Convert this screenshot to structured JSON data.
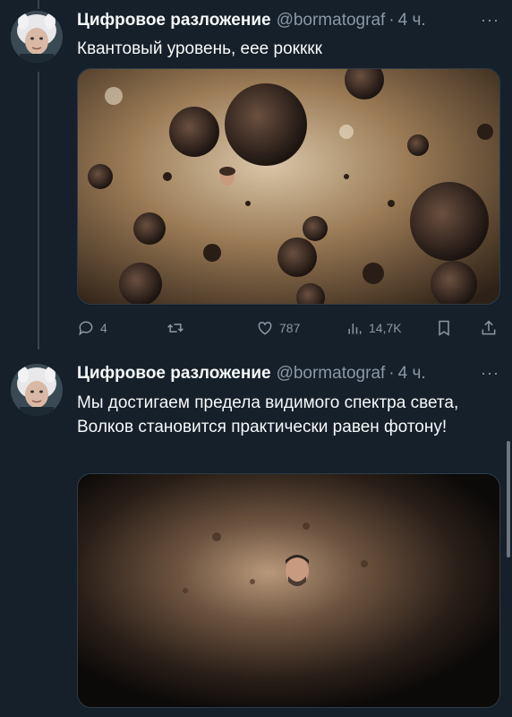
{
  "tweets": [
    {
      "name": "Цифровое разложение",
      "handle": "@bormatograf",
      "separator": "·",
      "time": "4 ч.",
      "more": "···",
      "text": "Квантовый уровень, еее рокккк",
      "stats": {
        "replies": "4",
        "retweets": "",
        "likes": "787",
        "views": "14,7K"
      }
    },
    {
      "name": "Цифровое разложение",
      "handle": "@bormatograf",
      "separator": "·",
      "time": "4 ч.",
      "more": "···",
      "text": "Мы достигаем предела видимого спектра света, Волков становится практически равен фотону!"
    }
  ],
  "colors": {
    "background": "#15202b",
    "primary_text": "#f7f9f9",
    "secondary_text": "#8b98a5",
    "thread_line": "#38444d"
  },
  "icons": [
    "reply-icon",
    "retweet-icon",
    "like-icon",
    "views-icon",
    "bookmark-icon",
    "share-icon",
    "more-icon"
  ]
}
